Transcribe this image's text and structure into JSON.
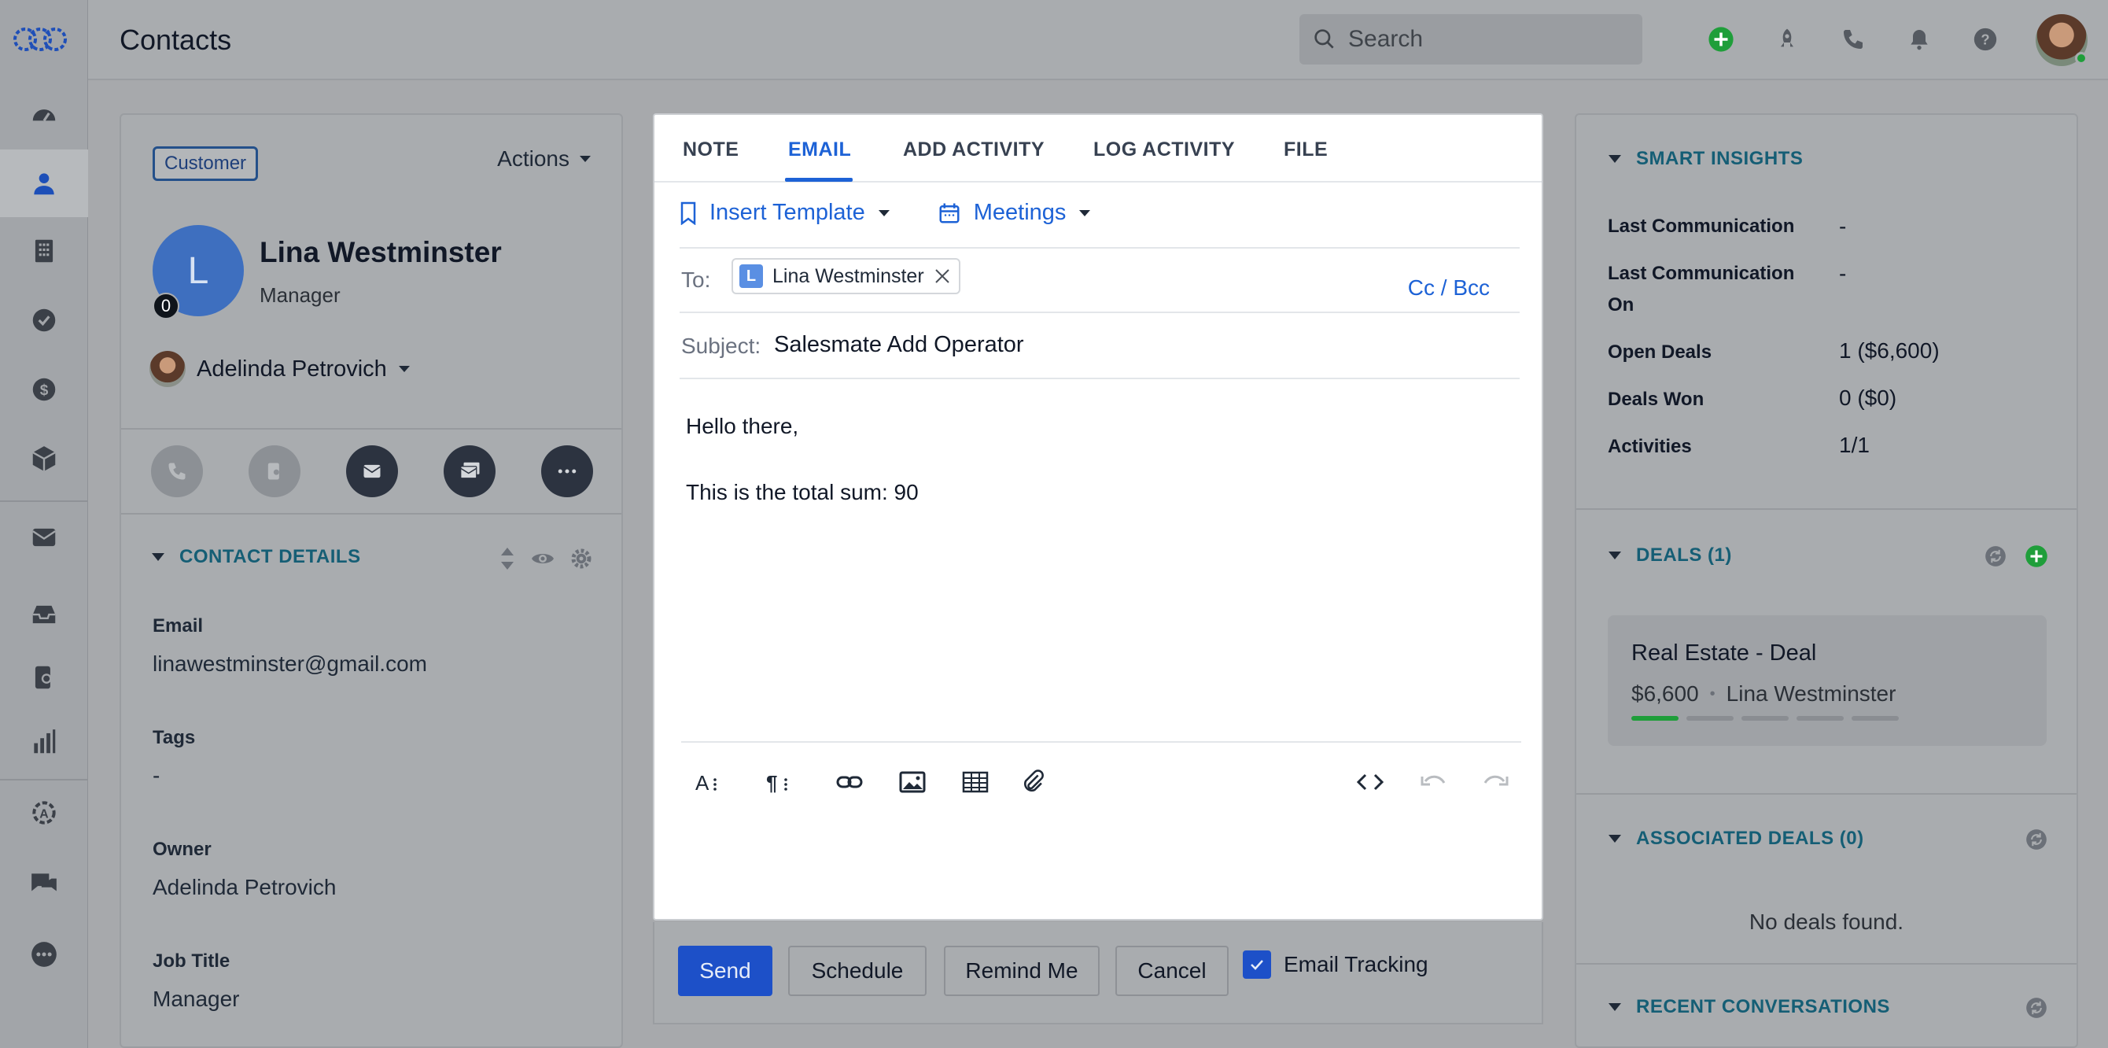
{
  "colors": {
    "accent_blue": "#1d62d6",
    "teal_heading": "#155e75",
    "green_add": "#1f9e3a",
    "dim_overlay_bg": "#a9acaf"
  },
  "header": {
    "title": "Contacts",
    "search_placeholder": "Search",
    "icons": [
      "add-icon",
      "rocket-icon",
      "phone-icon",
      "bell-icon",
      "help-icon",
      "user-avatar"
    ]
  },
  "nav": {
    "items": [
      "dashboard-icon",
      "contacts-icon",
      "companies-icon",
      "tasks-icon",
      "deals-icon",
      "products-icon",
      "email-icon",
      "inbox-icon",
      "sequences-icon",
      "reports-icon",
      "automation-icon",
      "chat-icon",
      "more-icon"
    ]
  },
  "contact": {
    "badge": "Customer",
    "actions_label": "Actions",
    "avatar_initial": "L",
    "avatar_count": "0",
    "name": "Lina Westminster",
    "role": "Manager",
    "owner": "Adelinda Petrovich"
  },
  "contact_details": {
    "heading": "CONTACT DETAILS",
    "fields": [
      {
        "label": "Email",
        "value": "linawestminster@gmail.com"
      },
      {
        "label": "Tags",
        "value": "-"
      },
      {
        "label": "Owner",
        "value": "Adelinda Petrovich"
      },
      {
        "label": "Job Title",
        "value": "Manager"
      }
    ]
  },
  "compose": {
    "tabs": [
      "NOTE",
      "EMAIL",
      "ADD ACTIVITY",
      "LOG ACTIVITY",
      "FILE"
    ],
    "active_tab": "EMAIL",
    "insert_template": "Insert Template",
    "meetings": "Meetings",
    "to_label": "To:",
    "recipient_initial": "L",
    "recipient_name": "Lina Westminster",
    "cc_bcc": "Cc / Bcc",
    "subject_label": "Subject:",
    "subject_value": "Salesmate Add Operator",
    "body_lines": [
      "Hello there,",
      "This is the total sum: 90"
    ],
    "toolbar": [
      "font-size-icon",
      "paragraph-icon",
      "link-icon",
      "image-icon",
      "table-icon",
      "attachment-icon",
      "code-icon",
      "undo-icon",
      "redo-icon"
    ],
    "buttons": {
      "send": "Send",
      "schedule": "Schedule",
      "remind_me": "Remind Me",
      "cancel": "Cancel"
    },
    "email_tracking_label": "Email Tracking",
    "email_tracking_checked": true
  },
  "smart_insights": {
    "heading": "SMART INSIGHTS",
    "rows": [
      {
        "label": "Last Communication",
        "value": "-"
      },
      {
        "label": "Last Communication On",
        "value": "-"
      },
      {
        "label": "Open Deals",
        "value": "1 ($6,600)"
      },
      {
        "label": "Deals Won",
        "value": "0 ($0)"
      },
      {
        "label": "Activities",
        "value": "1/1"
      }
    ]
  },
  "deals": {
    "heading": "DEALS (1)",
    "card": {
      "title": "Real Estate - Deal",
      "amount": "$6,600",
      "contact": "Lina Westminster",
      "stages_total": 5,
      "stages_complete": 1
    }
  },
  "associated_deals": {
    "heading": "ASSOCIATED DEALS (0)",
    "empty": "No deals found."
  },
  "recent_conversations": {
    "heading": "RECENT CONVERSATIONS"
  }
}
